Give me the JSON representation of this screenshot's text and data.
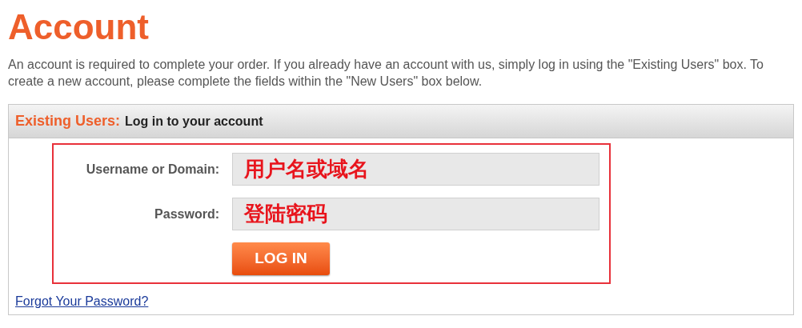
{
  "title": "Account",
  "intro": "An account is required to complete your order. If you already have an account with us, simply log in using the \"Existing Users\" box. To create a new account, please complete the fields within the \"New Users\" box below.",
  "panel": {
    "heading": "Existing Users:",
    "subheading": "Log in to your account",
    "fields": [
      {
        "label": "Username or Domain:",
        "value": "用户名或域名"
      },
      {
        "label": "Password:",
        "value": "登陆密码"
      }
    ],
    "button": "LOG IN",
    "link": "Forgot Your Password?"
  }
}
